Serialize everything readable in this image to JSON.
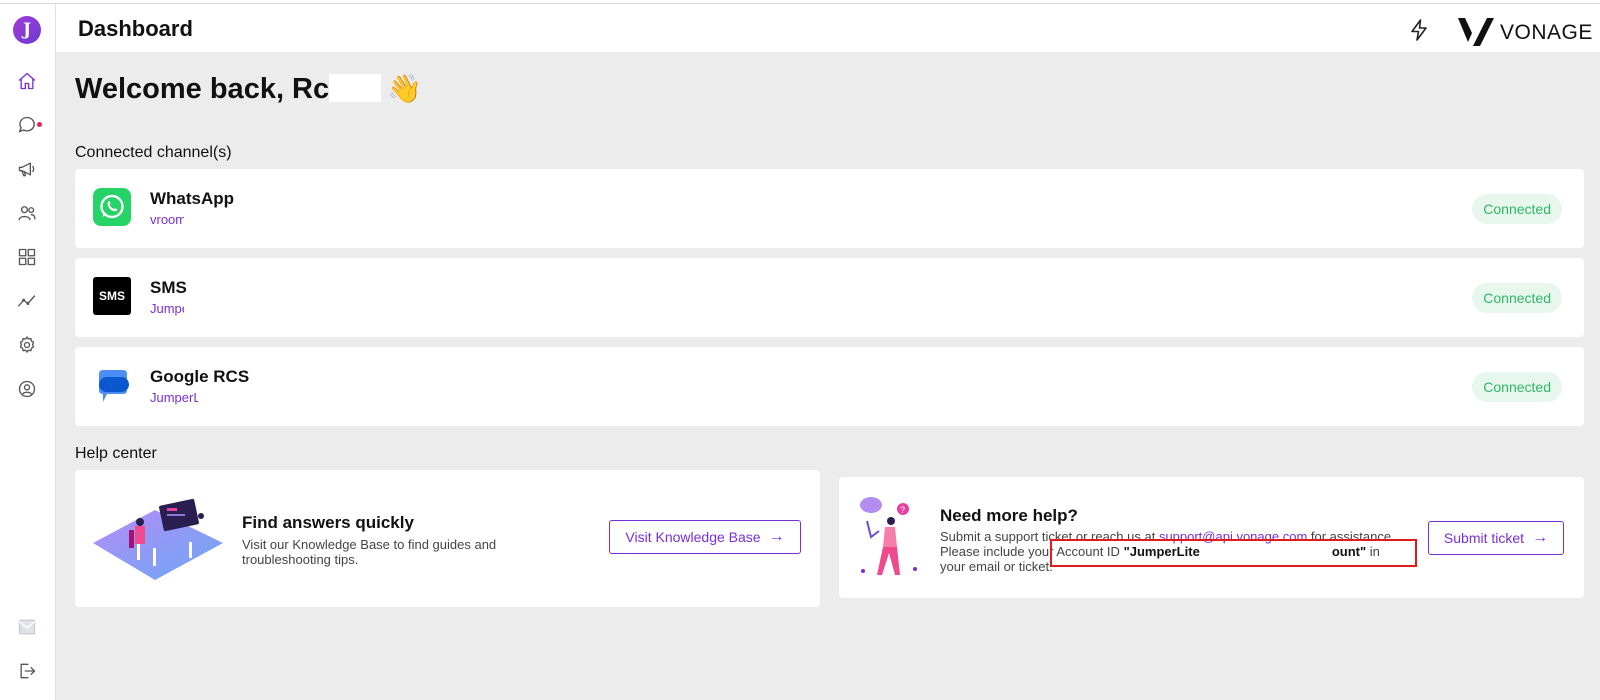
{
  "header": {
    "title": "Dashboard",
    "brand": "VONAGE"
  },
  "sidebar": {
    "logo_letter": "J",
    "items": [
      {
        "name": "home",
        "icon": "home-icon",
        "active": true
      },
      {
        "name": "conversations",
        "icon": "chat-icon",
        "active": false
      },
      {
        "name": "campaigns",
        "icon": "megaphone-icon",
        "active": false
      },
      {
        "name": "contacts",
        "icon": "users-icon",
        "active": false
      },
      {
        "name": "apps",
        "icon": "grid-icon",
        "active": false
      },
      {
        "name": "analytics",
        "icon": "trend-icon",
        "active": false
      },
      {
        "name": "settings",
        "icon": "gear-icon",
        "active": false
      },
      {
        "name": "profile",
        "icon": "user-circle-icon",
        "active": false
      }
    ],
    "bottom_items": [
      {
        "name": "messages",
        "icon": "mail-icon"
      },
      {
        "name": "logout",
        "icon": "logout-icon"
      }
    ]
  },
  "main": {
    "welcome": "Welcome back, Rc",
    "wave_emoji": "👋",
    "channels_label": "Connected channel(s)",
    "channels": [
      {
        "name": "WhatsApp",
        "sub": "vroom",
        "status": "Connected",
        "icon": "whatsapp-icon"
      },
      {
        "name": "SMS",
        "sub": "Jumpe",
        "status": "Connected",
        "icon": "sms-icon"
      },
      {
        "name": "Google RCS",
        "sub": "JumperL",
        "status": "Connected",
        "icon": "rcs-icon"
      }
    ],
    "help_label": "Help center",
    "knowledge": {
      "title": "Find answers quickly",
      "text_line1": "Visit our Knowledge Base to find guides and",
      "text_line2": "troubleshooting tips.",
      "button": "Visit Knowledge Base"
    },
    "support": {
      "title": "Need more help?",
      "line1_prefix": "Submit a support ticket or reach us at ",
      "email": "support@api.vonage.com",
      "line1_suffix": " for assistance.",
      "line2_prefix": "Please include your Account ID ",
      "account_id_start": "\"JumperLite",
      "account_id_end": "ount\"",
      "line2_suffix": " in",
      "line3": "your email or ticket.",
      "button": "Submit ticket"
    }
  },
  "colors": {
    "accent": "#7a2fd6",
    "connected_text": "#2fb865",
    "connected_bg": "#e8f7ee",
    "whatsapp": "#25d366",
    "highlight": "#e01b1b"
  }
}
